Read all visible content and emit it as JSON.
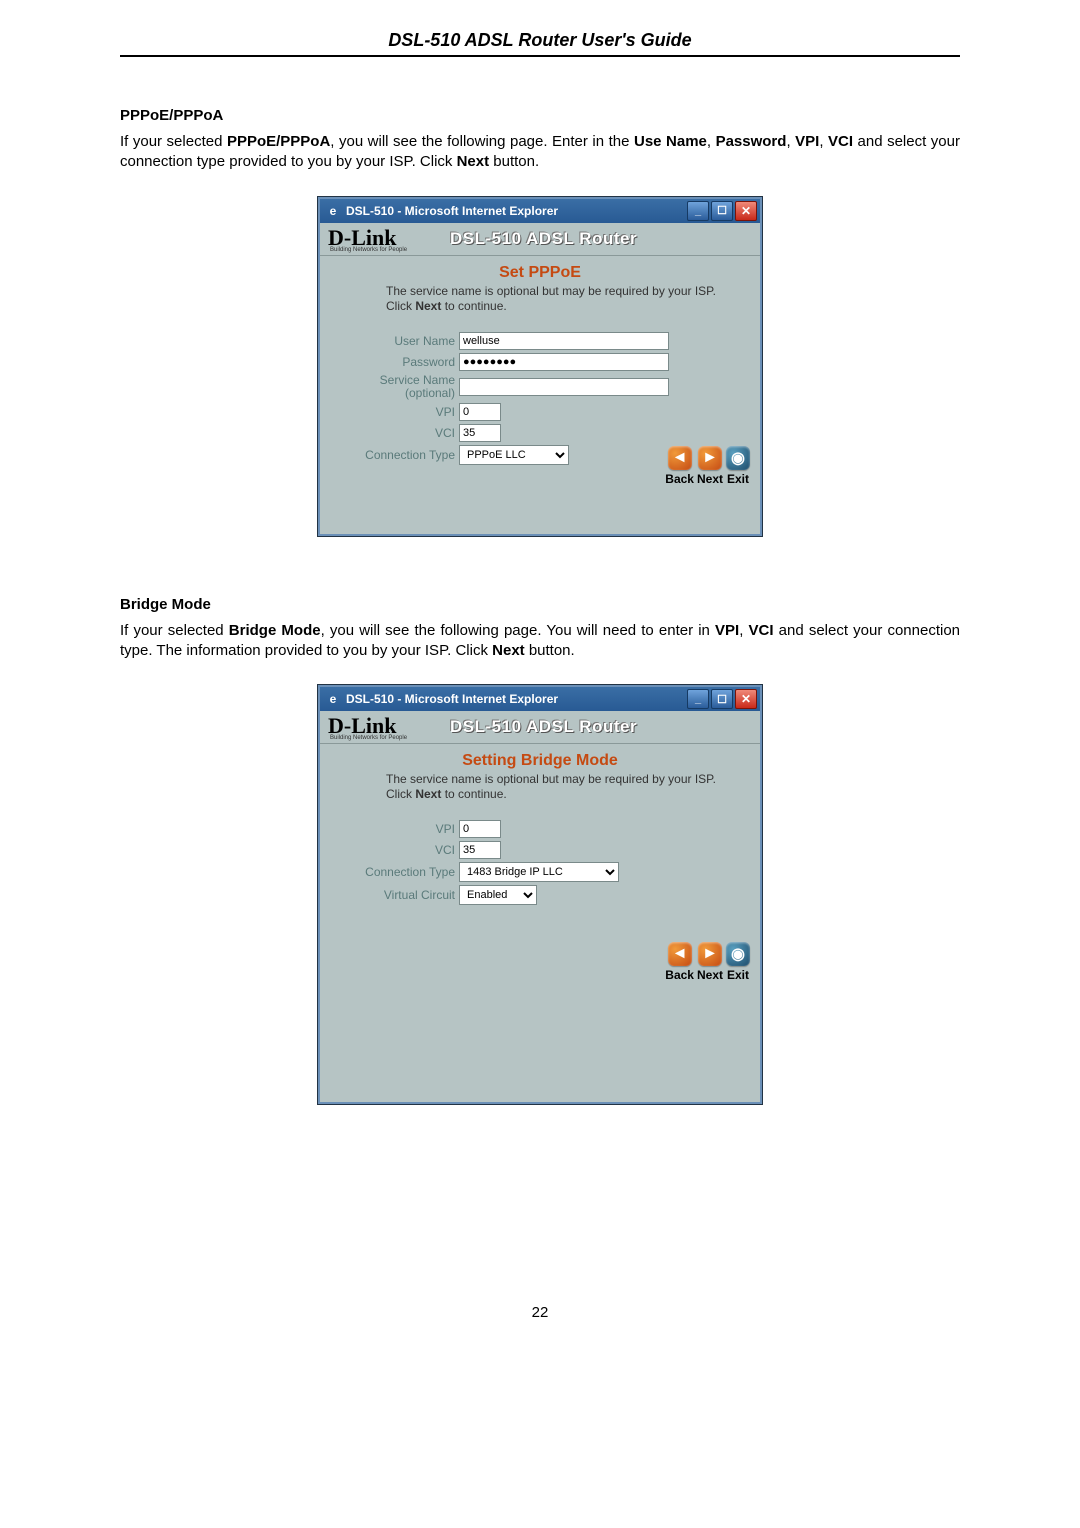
{
  "header": {
    "title": "DSL-510 ADSL Router User's Guide"
  },
  "section1": {
    "heading": "PPPoE/PPPoA",
    "para_parts": {
      "t1": "If your selected ",
      "b1": "PPPoE/PPPoA",
      "t2": ", you will see the following page. Enter in the ",
      "b2": "Use Name",
      "t3": ", ",
      "b3": "Password",
      "t4": ", ",
      "b4": "VPI",
      "t5": ", ",
      "b5": "VCI",
      "t6": " and select your connection type provided to you by your ISP. Click ",
      "b6": "Next",
      "t7": " button."
    }
  },
  "section2": {
    "heading": "Bridge Mode",
    "para_parts": {
      "t1": "If your selected ",
      "b1": "Bridge Mode",
      "t2": ", you will see the following page. You will need to enter in ",
      "b2": "VPI",
      "t3": ", ",
      "b3": "VCI",
      "t4": " and select your connection type. The information provided to you by your ISP. Click ",
      "b4": "Next",
      "t5": " button."
    }
  },
  "browser_common": {
    "title": "DSL-510 - Microsoft Internet Explorer",
    "logo": "D-Link",
    "logo_sub": "Building Networks for People",
    "router_label": "DSL-510 ADSL Router",
    "instr_line1": "The service name is optional but may be required by your ISP.",
    "instr_line2a": "Click ",
    "instr_line2b": "Next",
    "instr_line2c": " to continue.",
    "nav": {
      "back": "Back",
      "next": "Next",
      "exit": "Exit"
    }
  },
  "screen1": {
    "title": "Set PPPoE",
    "labels": {
      "username": "User Name",
      "password": "Password",
      "service": "Service Name (optional)",
      "vpi": "VPI",
      "vci": "VCI",
      "conn": "Connection Type"
    },
    "values": {
      "username": "welluse",
      "password": "●●●●●●●●",
      "service": "",
      "vpi": "0",
      "vci": "35",
      "conn": "PPPoE LLC"
    }
  },
  "screen2": {
    "title": "Setting Bridge Mode",
    "labels": {
      "vpi": "VPI",
      "vci": "VCI",
      "conn": "Connection Type",
      "vc": "Virtual Circuit"
    },
    "values": {
      "vpi": "0",
      "vci": "35",
      "conn": "1483 Bridge IP LLC",
      "vc": "Enabled"
    }
  },
  "page_number": "22"
}
